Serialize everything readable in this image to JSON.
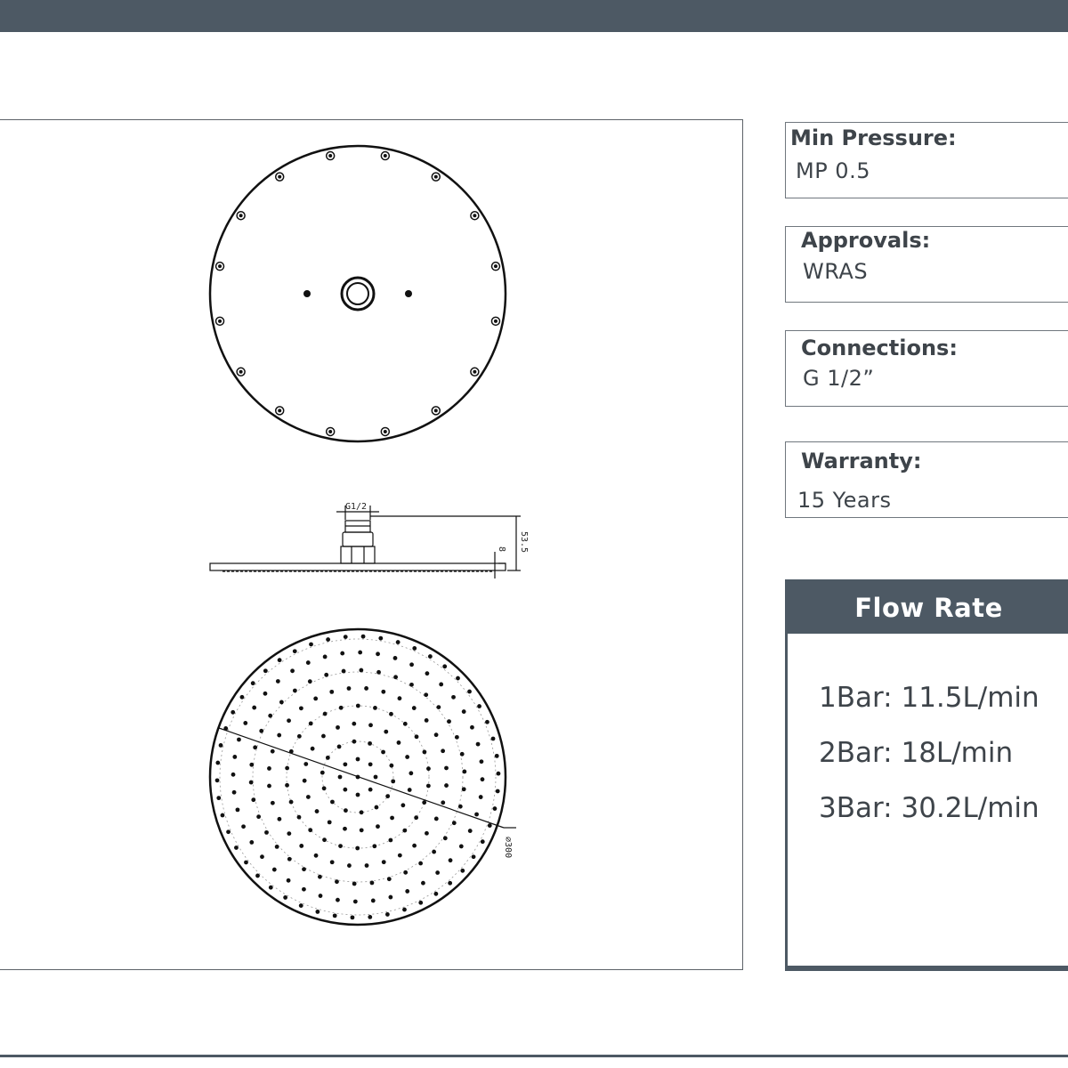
{
  "drawing": {
    "labels": {
      "connection": "G1/2",
      "height": "53.5",
      "thickness": "8",
      "diameter": "300"
    }
  },
  "specs": [
    {
      "label": "Min Pressure:",
      "value": "MP 0.5"
    },
    {
      "label": "Approvals:",
      "value": "WRAS"
    },
    {
      "label": "Connections:",
      "value": "G 1/2”"
    },
    {
      "label": "Warranty:",
      "value": "15 Years"
    }
  ],
  "flow_rate": {
    "title": "Flow Rate",
    "items": [
      "1Bar: 11.5L/min",
      "2Bar: 18L/min",
      "3Bar: 30.2L/min"
    ]
  },
  "colors": {
    "bar": "#4d5964",
    "text": "#3e444a",
    "line": "#1a1a1a"
  }
}
